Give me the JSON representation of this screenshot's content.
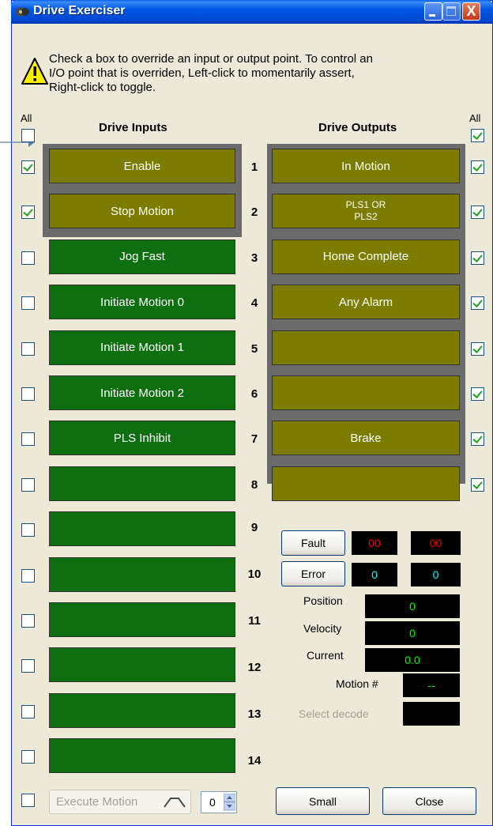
{
  "window": {
    "title": "Drive Exerciser",
    "help_text_lines": [
      "Check a box to override an input or output point. To control an",
      "I/O point that is overriden, Left-click to momentarily assert,",
      "Right-click to toggle."
    ],
    "close_glyph": "X"
  },
  "inputs": {
    "header": "Drive Inputs",
    "all_label": "All",
    "all_checked": false,
    "items": [
      {
        "num": "1",
        "label": "Enable",
        "checked": true,
        "overridden": true
      },
      {
        "num": "2",
        "label": "Stop Motion",
        "checked": true,
        "overridden": true
      },
      {
        "num": "3",
        "label": "Jog Fast",
        "checked": false,
        "overridden": false
      },
      {
        "num": "4",
        "label": "Initiate Motion 0",
        "checked": false,
        "overridden": false
      },
      {
        "num": "5",
        "label": "Initiate Motion 1",
        "checked": false,
        "overridden": false
      },
      {
        "num": "6",
        "label": "Initiate Motion 2",
        "checked": false,
        "overridden": false
      },
      {
        "num": "7",
        "label": "PLS Inhibit",
        "checked": false,
        "overridden": false
      },
      {
        "num": "8",
        "label": "",
        "checked": false,
        "overridden": false
      },
      {
        "num": "9",
        "label": "",
        "checked": false,
        "overridden": false
      },
      {
        "num": "10",
        "label": "",
        "checked": false,
        "overridden": false
      },
      {
        "num": "11",
        "label": "",
        "checked": false,
        "overridden": false
      },
      {
        "num": "12",
        "label": "",
        "checked": false,
        "overridden": false
      },
      {
        "num": "13",
        "label": "",
        "checked": false,
        "overridden": false
      },
      {
        "num": "14",
        "label": "",
        "checked": false,
        "overridden": false
      }
    ]
  },
  "outputs": {
    "header": "Drive Outputs",
    "all_label": "All",
    "all_checked": true,
    "items": [
      {
        "label": "In Motion",
        "checked": true
      },
      {
        "label": "PLS1 OR\nPLS2",
        "checked": true
      },
      {
        "label": "Home Complete",
        "checked": true
      },
      {
        "label": "Any Alarm",
        "checked": true
      },
      {
        "label": "",
        "checked": true
      },
      {
        "label": "",
        "checked": true
      },
      {
        "label": "Brake",
        "checked": true
      },
      {
        "label": "",
        "checked": true
      }
    ]
  },
  "status": {
    "fault_label": "Fault",
    "fault_value_1": "00",
    "fault_value_2": "00",
    "error_label": "Error",
    "error_value_1": "0",
    "error_value_2": "0",
    "position_label": "Position",
    "position_value": "0",
    "velocity_label": "Velocity",
    "velocity_value": "0",
    "current_label": "Current",
    "current_value": "0.0",
    "motion_label": "Motion #",
    "motion_value": "--",
    "select_decode_label": "Select decode",
    "select_decode_value": ""
  },
  "footer": {
    "execute_motion_label": "Execute Motion",
    "execute_checked": false,
    "motion_spinner_value": "0",
    "small_label": "Small",
    "close_label": "Close"
  },
  "colors": {
    "input_inactive": "#0e6f10",
    "input_active": "#7c7c00",
    "output_active": "#7c7c00",
    "fault_text": "#ff0000",
    "error_text": "#00ffff",
    "value_text": "#00ff00",
    "title_bar": "#0055e5"
  },
  "icons": {
    "app": "drive-app-icon",
    "warning": "warning-icon",
    "minimize": "minimize-icon",
    "maximize": "maximize-icon",
    "close": "close-icon",
    "motion_profile": "motion-profile-icon",
    "spinner": "spinner-arrows-icon",
    "pointer": "pointer-arrow-icon"
  }
}
